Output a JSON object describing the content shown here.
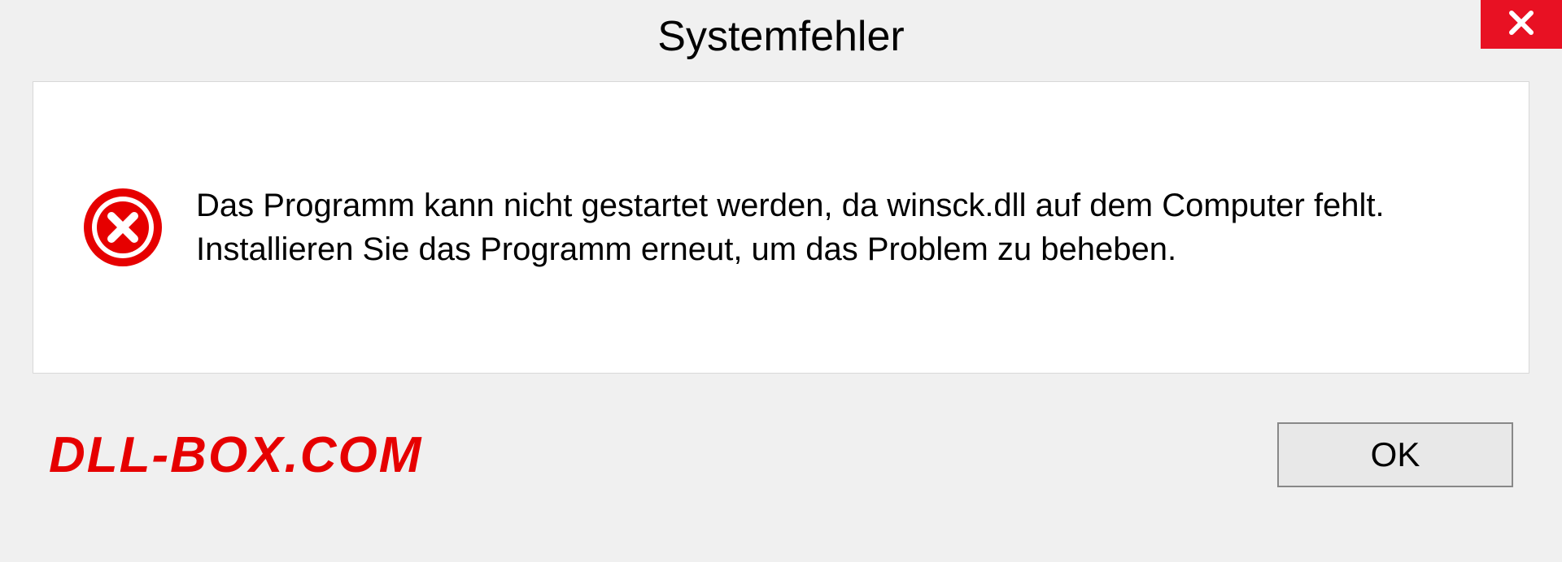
{
  "dialog": {
    "title": "Systemfehler",
    "message": "Das Programm kann nicht gestartet werden, da winsck.dll auf dem Computer fehlt. Installieren Sie das Programm erneut, um das Problem zu beheben.",
    "ok_label": "OK"
  },
  "watermark": "DLL-BOX.COM"
}
